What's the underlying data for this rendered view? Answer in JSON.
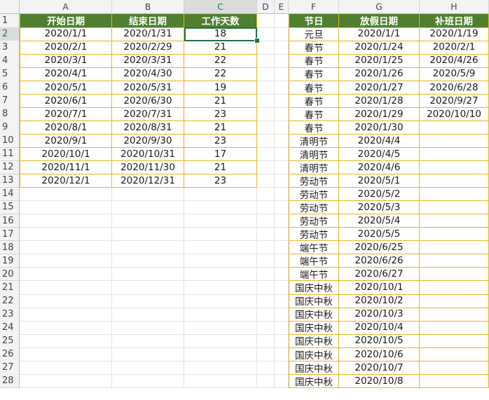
{
  "columns": [
    "A",
    "B",
    "C",
    "D",
    "E",
    "F",
    "G",
    "H"
  ],
  "selected_column": "C",
  "selected_row": 2,
  "rows": [
    "1",
    "2",
    "3",
    "4",
    "5",
    "6",
    "7",
    "8",
    "9",
    "10",
    "11",
    "12",
    "13",
    "14",
    "15",
    "16",
    "17",
    "18",
    "19",
    "20",
    "21",
    "22",
    "23",
    "24",
    "25",
    "26",
    "27",
    "28"
  ],
  "table1": {
    "headers": [
      "开始日期",
      "结束日期",
      "工作天数"
    ],
    "rows": [
      [
        "2020/1/1",
        "2020/1/31",
        "18"
      ],
      [
        "2020/2/1",
        "2020/2/29",
        "21"
      ],
      [
        "2020/3/1",
        "2020/3/31",
        "22"
      ],
      [
        "2020/4/1",
        "2020/4/30",
        "22"
      ],
      [
        "2020/5/1",
        "2020/5/31",
        "19"
      ],
      [
        "2020/6/1",
        "2020/6/30",
        "21"
      ],
      [
        "2020/7/1",
        "2020/7/31",
        "23"
      ],
      [
        "2020/8/1",
        "2020/8/31",
        "21"
      ],
      [
        "2020/9/1",
        "2020/9/30",
        "23"
      ],
      [
        "2020/10/1",
        "2020/10/31",
        "17"
      ],
      [
        "2020/11/1",
        "2020/11/30",
        "21"
      ],
      [
        "2020/12/1",
        "2020/12/31",
        "23"
      ]
    ]
  },
  "table2": {
    "headers": [
      "节日",
      "放假日期",
      "补班日期"
    ],
    "rows": [
      [
        "元旦",
        "2020/1/1",
        "2020/1/19"
      ],
      [
        "春节",
        "2020/1/24",
        "2020/2/1"
      ],
      [
        "春节",
        "2020/1/25",
        "2020/4/26"
      ],
      [
        "春节",
        "2020/1/26",
        "2020/5/9"
      ],
      [
        "春节",
        "2020/1/27",
        "2020/6/28"
      ],
      [
        "春节",
        "2020/1/28",
        "2020/9/27"
      ],
      [
        "春节",
        "2020/1/29",
        "2020/10/10"
      ],
      [
        "春节",
        "2020/1/30",
        ""
      ],
      [
        "清明节",
        "2020/4/4",
        ""
      ],
      [
        "清明节",
        "2020/4/5",
        ""
      ],
      [
        "清明节",
        "2020/4/6",
        ""
      ],
      [
        "劳动节",
        "2020/5/1",
        ""
      ],
      [
        "劳动节",
        "2020/5/2",
        ""
      ],
      [
        "劳动节",
        "2020/5/3",
        ""
      ],
      [
        "劳动节",
        "2020/5/4",
        ""
      ],
      [
        "劳动节",
        "2020/5/5",
        ""
      ],
      [
        "端午节",
        "2020/6/25",
        ""
      ],
      [
        "端午节",
        "2020/6/26",
        ""
      ],
      [
        "端午节",
        "2020/6/27",
        ""
      ],
      [
        "国庆中秋",
        "2020/10/1",
        ""
      ],
      [
        "国庆中秋",
        "2020/10/2",
        ""
      ],
      [
        "国庆中秋",
        "2020/10/3",
        ""
      ],
      [
        "国庆中秋",
        "2020/10/4",
        ""
      ],
      [
        "国庆中秋",
        "2020/10/5",
        ""
      ],
      [
        "国庆中秋",
        "2020/10/6",
        ""
      ],
      [
        "国庆中秋",
        "2020/10/7",
        ""
      ],
      [
        "国庆中秋",
        "2020/10/8",
        ""
      ]
    ]
  }
}
